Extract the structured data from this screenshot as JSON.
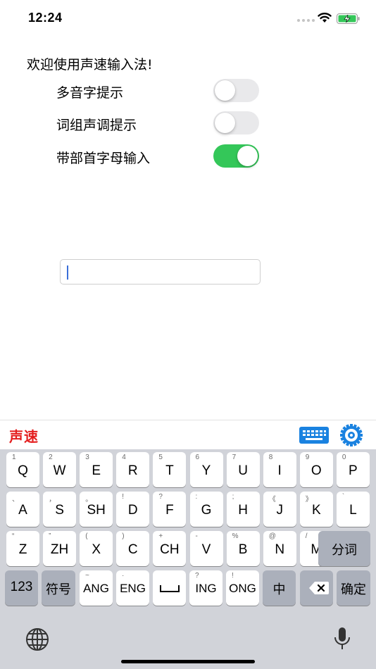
{
  "status_bar": {
    "time": "12:24"
  },
  "app": {
    "welcome": "欢迎使用声速输入法!",
    "settings": [
      {
        "label": "多音字提示",
        "on": false
      },
      {
        "label": "词组声调提示",
        "on": false
      },
      {
        "label": "带部首字母输入",
        "on": true
      }
    ],
    "input": {
      "value": ""
    }
  },
  "ime_bar": {
    "logo": "声速",
    "keyboard_icon": "keyboard-icon",
    "settings_icon": "gear-icon"
  },
  "keyboard": {
    "row1": [
      {
        "hint": "1",
        "main": "Q"
      },
      {
        "hint": "2",
        "main": "W"
      },
      {
        "hint": "3",
        "main": "E"
      },
      {
        "hint": "4",
        "main": "R"
      },
      {
        "hint": "5",
        "main": "T"
      },
      {
        "hint": "6",
        "main": "Y"
      },
      {
        "hint": "7",
        "main": "U"
      },
      {
        "hint": "8",
        "main": "I"
      },
      {
        "hint": "9",
        "main": "O"
      },
      {
        "hint": "0",
        "main": "P"
      }
    ],
    "row2": [
      {
        "hint": "、",
        "main": "A"
      },
      {
        "hint": "，",
        "main": "S"
      },
      {
        "hint": "。",
        "main": "SH"
      },
      {
        "hint": "!",
        "main": "D"
      },
      {
        "hint": "?",
        "main": "F"
      },
      {
        "hint": ":",
        "main": "G"
      },
      {
        "hint": ";",
        "main": "H"
      },
      {
        "hint": "《",
        "main": "J"
      },
      {
        "hint": "》",
        "main": "K"
      },
      {
        "hint": "`",
        "main": "L"
      }
    ],
    "row3": [
      {
        "hint": "“",
        "main": "Z"
      },
      {
        "hint": "”",
        "main": "ZH"
      },
      {
        "hint": "(",
        "main": "X"
      },
      {
        "hint": ")",
        "main": "C"
      },
      {
        "hint": "+",
        "main": "CH"
      },
      {
        "hint": "-",
        "main": "V"
      },
      {
        "hint": "%",
        "main": "B"
      },
      {
        "hint": "@",
        "main": "N"
      },
      {
        "hint": "/",
        "main": "M"
      }
    ],
    "row3_func": "分词",
    "row4": {
      "num": "123",
      "symbols": "符号",
      "ang": {
        "hint": "~",
        "main": "ANG"
      },
      "eng": {
        "hint": "·",
        "main": "ENG"
      },
      "ing": {
        "hint": "?",
        "main": "ING"
      },
      "ong": {
        "hint": "!",
        "main": "ONG"
      },
      "zh": "中",
      "confirm": "确定"
    },
    "globe_icon": "globe-icon",
    "mic_icon": "microphone-icon"
  }
}
